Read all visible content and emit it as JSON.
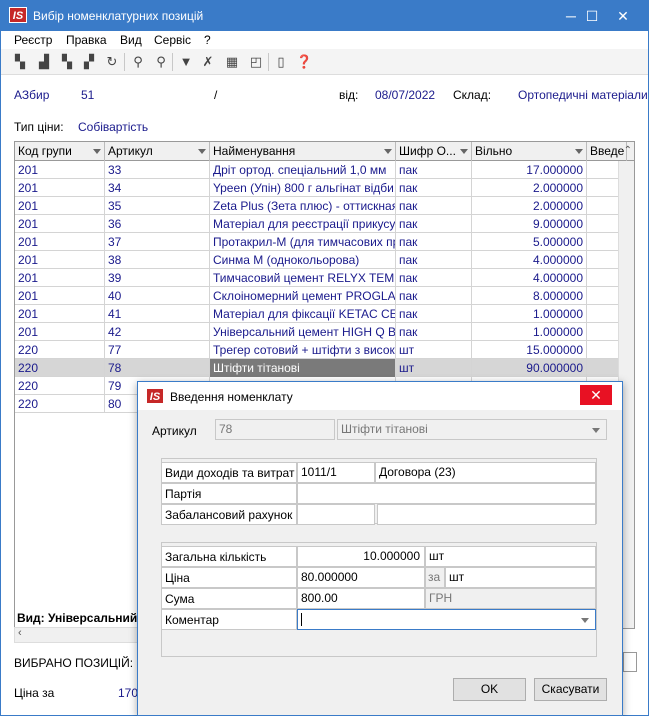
{
  "window": {
    "title": "Вибір номенклатурних позицій",
    "logo": "IS"
  },
  "menu": [
    "Реєстр",
    "Правка",
    "Вид",
    "Сервіс",
    "?"
  ],
  "toolbar_icons": [
    "copy-icon",
    "new-icon",
    "duplicate-icon",
    "delete-icon",
    "refresh-icon",
    "find-icon",
    "find-next-icon",
    "filter-icon",
    "clear-filter-icon",
    "table-icon",
    "clipboard-icon",
    "document-icon",
    "help-icon"
  ],
  "header": {
    "doc_code": "АЗбир",
    "doc_number": "51",
    "slash": "/",
    "date_label": "від:",
    "date": "08/07/2022",
    "warehouse_label": "Склад:",
    "warehouse": "Ортопедичні матеріали",
    "price_type_label": "Тип ціни:",
    "price_type": "Собівартість"
  },
  "grid": {
    "columns": [
      "Код групи",
      "Артикул",
      "Найменування",
      "Шифр О...",
      "Вільно",
      "Введе"
    ],
    "rows": [
      [
        "201",
        "33",
        "Дріт ортод. спеціальний 1,0 мм",
        "пак",
        "17.000000"
      ],
      [
        "201",
        "34",
        "Ypeen (Упін) 800 г альгінат відби...",
        "пак",
        "2.000000"
      ],
      [
        "201",
        "35",
        "Zeta Plus (Зета плюс) - оттискная...",
        "пак",
        "2.000000"
      ],
      [
        "201",
        "36",
        "Матеріал для реєстрації прикусу ...",
        "пак",
        "9.000000"
      ],
      [
        "201",
        "37",
        "Протакрил-М (для тимчасових пр...",
        "пак",
        "5.000000"
      ],
      [
        "201",
        "38",
        "Синма М (однокольорова)",
        "пак",
        "4.000000"
      ],
      [
        "201",
        "39",
        "Тимчасовий цемент RELYX TEMP N...",
        "пак",
        "4.000000"
      ],
      [
        "201",
        "40",
        "Склоіномерний цемент PROGLASS ...",
        "пак",
        "8.000000"
      ],
      [
        "201",
        "41",
        "Матеріал для фіксації KETAC CEM,...",
        "пак",
        "1.000000"
      ],
      [
        "201",
        "42",
        "Універсальний цемент HIGH Q Bo...",
        "пак",
        "1.000000"
      ],
      [
        "220",
        "77",
        "Трегер сотовий + штіфти з висок...",
        "шт",
        "15.000000"
      ],
      [
        "220",
        "78",
        "Штіфти тітанові",
        "шт",
        "90.000000"
      ],
      [
        "220",
        "79",
        "",
        "",
        ""
      ],
      [
        "220",
        "80",
        "",
        "",
        ""
      ]
    ],
    "selected_index": 11
  },
  "footer": {
    "view_label": "Вид: Універсальний ц",
    "selected_label": "ВИБРАНО ПОЗИЦІЙ:",
    "price_label": "Ціна за",
    "price_value": "170"
  },
  "dialog": {
    "title": "Введення номенклату",
    "logo": "IS",
    "article_label": "Артикул",
    "article_value": "78",
    "article_name": "Штіфти тітанові",
    "income_label": "Види доходів та витрат",
    "income_code": "1011/1",
    "income_name": "Договора (23)",
    "batch_label": "Партія",
    "offbalance_label": "Забалансовий рахунок",
    "qty_label": "Загальна кількість",
    "qty_value": "10.000000",
    "qty_unit": "шт",
    "price_label": "Ціна",
    "price_value": "80.000000",
    "price_per": "за",
    "price_unit": "шт",
    "sum_label": "Сума",
    "sum_value": "800.00",
    "sum_currency": "ГРН",
    "comment_label": "Коментар",
    "comment_value": "",
    "ok_label": "OK",
    "cancel_label": "Скасувати"
  }
}
